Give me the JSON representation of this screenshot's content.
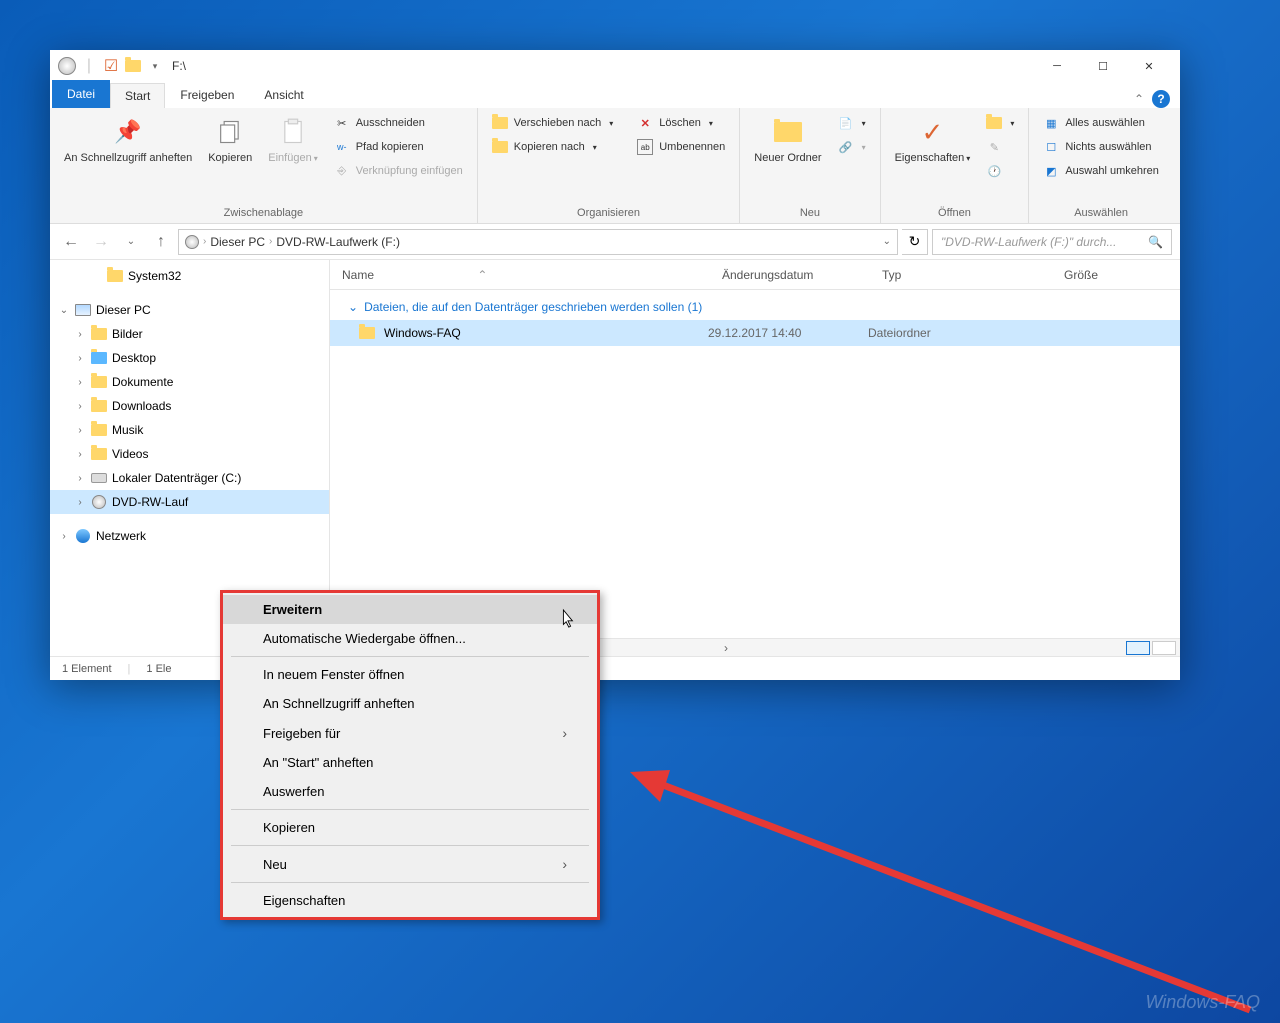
{
  "titlebar": {
    "title": "F:\\"
  },
  "tabs": {
    "file": "Datei",
    "items": [
      "Start",
      "Freigeben",
      "Ansicht"
    ],
    "active": 0
  },
  "ribbon": {
    "clipboard": {
      "label": "Zwischenablage",
      "pin": "An Schnellzugriff anheften",
      "copy": "Kopieren",
      "paste": "Einfügen",
      "cut": "Ausschneiden",
      "copypath": "Pfad kopieren",
      "pasteshortcut": "Verknüpfung einfügen"
    },
    "organize": {
      "label": "Organisieren",
      "moveto": "Verschieben nach",
      "copyto": "Kopieren nach",
      "delete": "Löschen",
      "rename": "Umbenennen"
    },
    "new": {
      "label": "Neu",
      "newfolder": "Neuer Ordner"
    },
    "open": {
      "label": "Öffnen",
      "properties": "Eigenschaften"
    },
    "select": {
      "label": "Auswählen",
      "selectall": "Alles auswählen",
      "selectnone": "Nichts auswählen",
      "invert": "Auswahl umkehren"
    }
  },
  "addr": {
    "crumbs": [
      "Dieser PC",
      "DVD-RW-Laufwerk (F:)"
    ]
  },
  "search": {
    "placeholder": "\"DVD-RW-Laufwerk (F:)\" durch..."
  },
  "tree": {
    "system32": "System32",
    "thispc": "Dieser PC",
    "items": [
      "Bilder",
      "Desktop",
      "Dokumente",
      "Downloads",
      "Musik",
      "Videos",
      "Lokaler Datenträger (C:)",
      "DVD-RW-Lauf"
    ],
    "network": "Netzwerk"
  },
  "columns": {
    "name": "Name",
    "date": "Änderungsdatum",
    "type": "Typ",
    "size": "Größe"
  },
  "group": "Dateien, die auf den Datenträger geschrieben werden sollen (1)",
  "row": {
    "name": "Windows-FAQ",
    "date": "29.12.2017 14:40",
    "type": "Dateiordner"
  },
  "status": {
    "count": "1 Element",
    "selected": "1 Ele"
  },
  "context": {
    "items": [
      "Erweitern",
      "Automatische Wiedergabe öffnen...",
      "In neuem Fenster öffnen",
      "An Schnellzugriff anheften",
      "Freigeben für",
      "An \"Start\" anheften",
      "Auswerfen",
      "Kopieren",
      "Neu",
      "Eigenschaften"
    ]
  },
  "watermark": "Windows-FAQ"
}
